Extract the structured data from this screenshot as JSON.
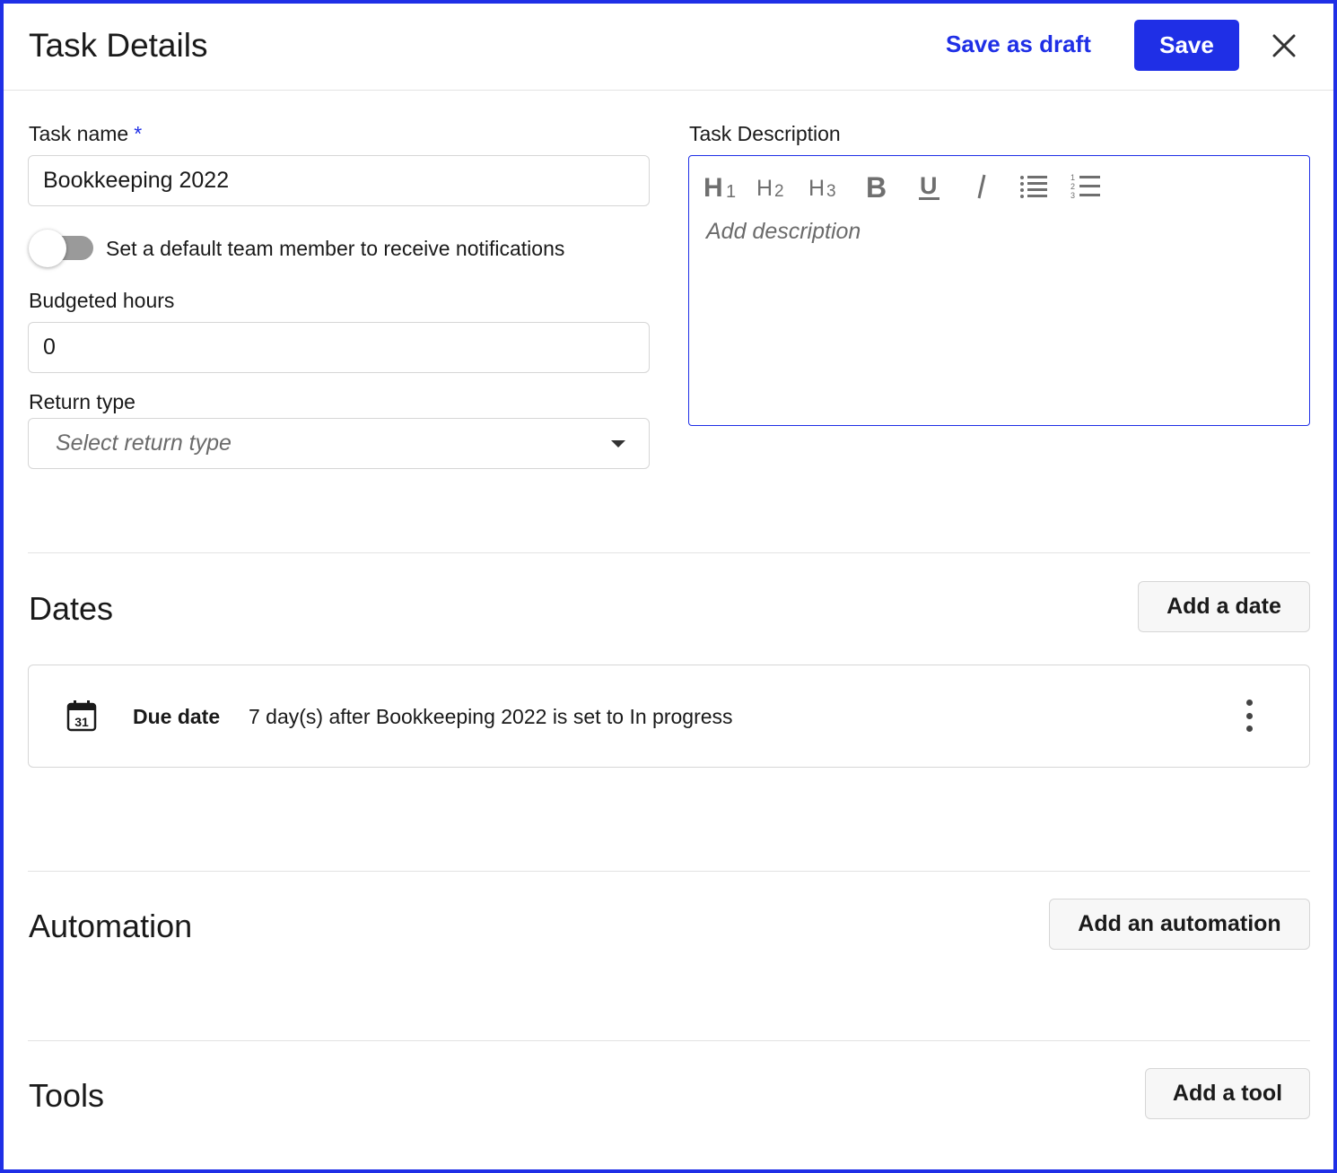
{
  "header": {
    "title": "Task Details",
    "save_draft_label": "Save as draft",
    "save_label": "Save",
    "close_icon": "close-icon"
  },
  "form": {
    "task_name_label": "Task name",
    "task_name_required": "*",
    "task_name_value": "Bookkeeping 2022",
    "toggle_label": "Set a default team member to receive notifications",
    "toggle_on": false,
    "budgeted_hours_label": "Budgeted hours",
    "budgeted_hours_value": "0",
    "return_type_label": "Return type",
    "return_type_placeholder": "Select return type"
  },
  "description": {
    "label": "Task Description",
    "placeholder": "Add description",
    "toolbar": [
      "heading-1-icon",
      "heading-2-icon",
      "heading-3-icon",
      "bold-icon",
      "underline-icon",
      "italic-icon",
      "bullet-list-icon",
      "numbered-list-icon"
    ]
  },
  "dates": {
    "title": "Dates",
    "add_label": "Add a date",
    "items": [
      {
        "icon": "calendar-icon",
        "calendar_day": "31",
        "label": "Due date",
        "text": "7 day(s) after Bookkeeping 2022 is set to In progress"
      }
    ]
  },
  "automation": {
    "title": "Automation",
    "add_label": "Add an automation"
  },
  "tools": {
    "title": "Tools",
    "add_label": "Add a tool"
  },
  "colors": {
    "accent": "#1f2fe6",
    "border": "#d6d6d6",
    "toggle_track": "#9a9a9a"
  }
}
